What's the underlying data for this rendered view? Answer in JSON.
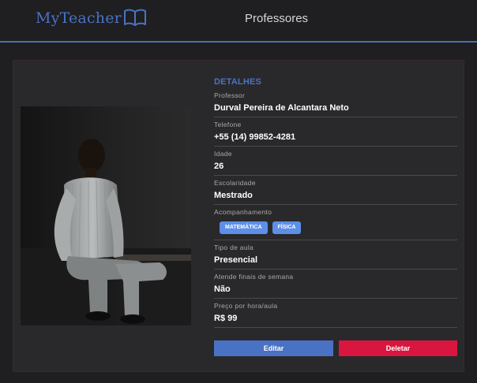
{
  "header": {
    "logo_text": "MyTeacher",
    "logo_icon": "open-book-icon",
    "nav_title": "Professores"
  },
  "photo": {
    "description_icon": "teacher-photo"
  },
  "details": {
    "section_title": "DETALHES",
    "fields": [
      {
        "label": "Professor",
        "value": "Durval Pereira de Alcantara Neto"
      },
      {
        "label": "Telefone",
        "value": "+55 (14) 99852-4281"
      },
      {
        "label": "Idade",
        "value": "26"
      },
      {
        "label": "Escolaridade",
        "value": "Mestrado"
      }
    ],
    "acompanhamento": {
      "label": "Acompanhamento",
      "tags": [
        "MATEMÁTICA",
        "FÍSICA"
      ]
    },
    "fields2": [
      {
        "label": "Tipo de aula",
        "value": "Presencial"
      },
      {
        "label": "Atende finais de semana",
        "value": "Não"
      },
      {
        "label": "Preço por hora/aula",
        "value": "R$ 99"
      }
    ]
  },
  "actions": {
    "edit_label": "Editar",
    "delete_label": "Deletar"
  },
  "colors": {
    "accent": "#4a72c4",
    "danger": "#d9163f",
    "tag": "#5e8fe8",
    "background": "#1f1f21",
    "card": "#29292b"
  }
}
